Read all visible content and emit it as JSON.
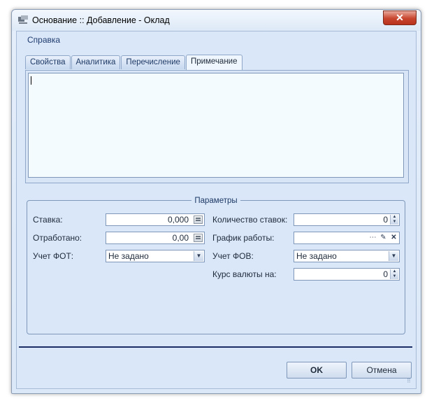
{
  "window": {
    "title": "Основание :: Добавление - Оклад",
    "close_label": "✕"
  },
  "menu": {
    "help": "Справка"
  },
  "tabs": [
    {
      "label": "Свойства"
    },
    {
      "label": "Аналитика"
    },
    {
      "label": "Перечисление"
    },
    {
      "label": "Примечание",
      "active": true
    }
  ],
  "note": {
    "value": ""
  },
  "params": {
    "group_title": "Параметры",
    "rate": {
      "label": "Ставка:",
      "value": "0,000"
    },
    "worked": {
      "label": "Отработано:",
      "value": "0,00"
    },
    "fot": {
      "label": "Учет ФОТ:",
      "value": "Не задано"
    },
    "rate_count": {
      "label": "Количество ставок:",
      "value": "0"
    },
    "schedule": {
      "label": "График работы:",
      "value": ""
    },
    "fov": {
      "label": "Учет ФОВ:",
      "value": "Не задано"
    },
    "currency_rate": {
      "label": "Курс валюты на:",
      "value": "0"
    }
  },
  "buttons": {
    "ok": "OK",
    "cancel": "Отмена"
  },
  "colors": {
    "accent": "#1b2f66",
    "background": "#dae7f8"
  }
}
